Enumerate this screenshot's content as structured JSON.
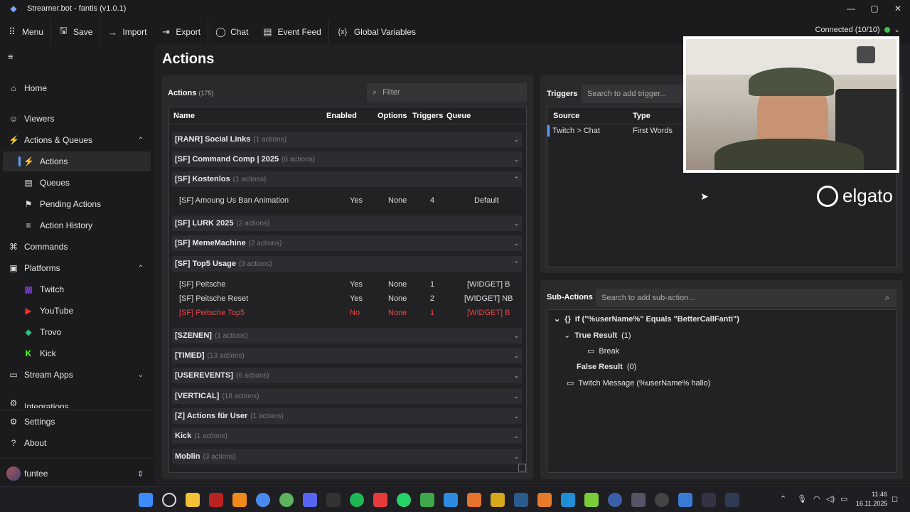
{
  "window": {
    "title": "Streamer.bot - fantis (v1.0.1)",
    "minimize": "—",
    "maximize": "▢",
    "close": "✕"
  },
  "toolbar": [
    {
      "icon": "grid-icon",
      "glyph": "⠿",
      "label": "Menu"
    },
    {
      "icon": "save-icon",
      "glyph": "🖫",
      "label": "Save"
    },
    {
      "icon": "import-icon",
      "glyph": "→",
      "label": "Import"
    },
    {
      "icon": "export-icon",
      "glyph": "⇥",
      "label": "Export"
    },
    {
      "icon": "chat-icon",
      "glyph": "◯",
      "label": "Chat"
    },
    {
      "icon": "event-feed-icon",
      "glyph": "▤",
      "label": "Event Feed"
    },
    {
      "icon": "variables-icon",
      "glyph": "{x}",
      "label": "Global Variables"
    }
  ],
  "connection": {
    "label": "Connected (10/10)",
    "status_color": "#3fc34a"
  },
  "sidebar": {
    "items": [
      {
        "label": "Home",
        "glyph": "⌂"
      },
      {
        "label": "Viewers",
        "glyph": "☺"
      },
      {
        "label": "Actions & Queues",
        "glyph": "⚡",
        "expanded": "⌃"
      },
      {
        "label": "Actions",
        "glyph": "⚡"
      },
      {
        "label": "Queues",
        "glyph": "▤"
      },
      {
        "label": "Pending Actions",
        "glyph": "⚑"
      },
      {
        "label": "Action History",
        "glyph": "≡"
      },
      {
        "label": "Commands",
        "glyph": "⌘"
      },
      {
        "label": "Platforms",
        "glyph": "▣",
        "expanded": "⌃"
      },
      {
        "label": "Twitch",
        "glyph": "▩"
      },
      {
        "label": "YouTube",
        "glyph": "▶"
      },
      {
        "label": "Trovo",
        "glyph": "◆"
      },
      {
        "label": "Kick",
        "glyph": "K"
      },
      {
        "label": "Stream Apps",
        "glyph": "▭",
        "expanded": "⌄"
      },
      {
        "label": "Integrations",
        "glyph": "⚙"
      },
      {
        "label": "Settings",
        "glyph": "⚙"
      },
      {
        "label": "About",
        "glyph": "?"
      }
    ],
    "user": {
      "name": "funtee",
      "chevron": "⇕"
    }
  },
  "page_title": "Actions",
  "actions_panel": {
    "title": "Actions",
    "count": "(175)",
    "filter_placeholder": "Filter",
    "columns": [
      "Name",
      "Enabled",
      "Options",
      "Triggers",
      "Queue"
    ],
    "groups": [
      {
        "name": "[RANR] Social Links",
        "count": "(1 actions)"
      },
      {
        "name": "[SF] Command Comp | 2025",
        "count": "(6 actions)"
      },
      {
        "name": "[SF] Kostenlos",
        "count": "(1 actions)"
      },
      {
        "name": "[SF] LURK 2025",
        "count": "(2 actions)"
      },
      {
        "name": "[SF] MemeMachine",
        "count": "(2 actions)"
      },
      {
        "name": "[SF] Top5 Usage",
        "count": "(3 actions)"
      },
      {
        "name": "[SZENEN]",
        "count": "(1 actions)"
      },
      {
        "name": "[TIMED]",
        "count": "(13 actions)"
      },
      {
        "name": "[USEREVENTS]",
        "count": "(6 actions)"
      },
      {
        "name": "[VERTICAL]",
        "count": "(18 actions)"
      },
      {
        "name": "[Z] Actions für User",
        "count": "(1 actions)"
      },
      {
        "name": "Kick",
        "count": "(1 actions)"
      },
      {
        "name": "Moblin",
        "count": "(3 actions)"
      }
    ],
    "rows": [
      {
        "name": "[SF] Amoung Us Ban Animation",
        "enabled": "Yes",
        "options": "None",
        "triggers": "4",
        "queue": "Default"
      },
      {
        "name": "[SF] Peitsche",
        "enabled": "Yes",
        "options": "None",
        "triggers": "1",
        "queue": "[WIDGET] B"
      },
      {
        "name": "[SF] Peitsche Reset",
        "enabled": "Yes",
        "options": "None",
        "triggers": "2",
        "queue": "[WIDGET] NB"
      },
      {
        "name": "[SF] Peitsche Top5",
        "enabled": "No",
        "options": "None",
        "triggers": "1",
        "queue": "[WIDGET] B"
      }
    ]
  },
  "triggers_panel": {
    "title": "Triggers",
    "search_placeholder": "Search to add trigger...",
    "columns": [
      "Source",
      "Type"
    ],
    "rows": [
      {
        "source": "Twitch > Chat",
        "type": "First Words"
      }
    ]
  },
  "subactions_panel": {
    "title": "Sub-Actions",
    "search_placeholder": "Search to add sub-action...",
    "items": [
      {
        "text": "if (\"%userName%\" Equals \"BetterCallFanti\")",
        "glyph": "{}",
        "toggle": "⌄"
      },
      {
        "text": "True Result",
        "count": "(1)",
        "toggle": "⌄"
      },
      {
        "text": "Break",
        "glyph": "▭"
      },
      {
        "text": "False Result",
        "count": "(0)"
      },
      {
        "text": "Twitch Message (%userName% hallo)",
        "glyph": "▭"
      }
    ]
  },
  "overlay": {
    "brand": "elgato"
  },
  "taskbar": {
    "time": "11:46",
    "date": "16.11.2025"
  }
}
